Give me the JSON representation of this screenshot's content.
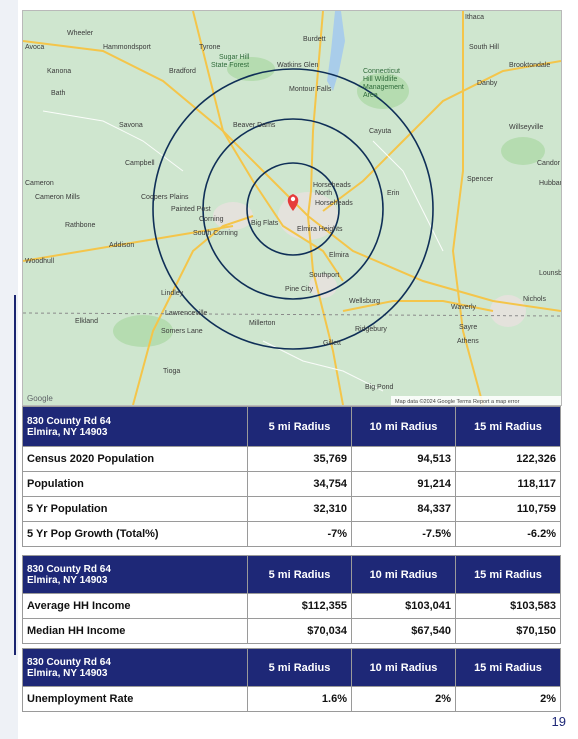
{
  "map": {
    "places": [
      "Ithaca",
      "South Hill",
      "Brooktondale",
      "Danby",
      "Wheeler",
      "Hammondsport",
      "Tyrone",
      "Burdett",
      "Avoca",
      "Kanona",
      "Bradford",
      "Sugar Hill State Forest",
      "Watkins Glen",
      "Connecticut Hill Wildlife Management Area",
      "Bath",
      "Montour Falls",
      "Savona",
      "Beaver Dams",
      "Cayuta",
      "Willseyville",
      "Campbell",
      "Candor",
      "Spencer",
      "Hubbard",
      "Cameron",
      "Cameron Mills",
      "Coopers Plains",
      "Painted Post",
      "Corning",
      "South Corning",
      "Big Flats",
      "Horseheads North",
      "Horseheads",
      "Elmira Heights",
      "Erin",
      "Rathbone",
      "Addison",
      "Elmira",
      "Woodhull",
      "Southport",
      "Pine City",
      "Lindley",
      "Wellsburg",
      "Waverly",
      "Nichols",
      "Lounsberry",
      "Lawrenceville",
      "Elkland",
      "Somers Lane",
      "Millerton",
      "Sayre",
      "Athens",
      "Ridgebury",
      "Gillett",
      "Tioga",
      "Big Pond"
    ],
    "attribution": "Map data ©2024 Google   Terms   Report a map error",
    "google_logo": "Google"
  },
  "tables": [
    {
      "address_line1": "830 County Rd 64",
      "address_line2": "Elmira, NY 14903",
      "col1": "5 mi Radius",
      "col2": "10 mi Radius",
      "col3": "15 mi Radius",
      "rows": [
        {
          "label": "Census 2020 Population",
          "v1": "35,769",
          "v2": "94,513",
          "v3": "122,326"
        },
        {
          "label": "Population",
          "v1": "34,754",
          "v2": "91,214",
          "v3": "118,117"
        },
        {
          "label": "5 Yr Population",
          "v1": "32,310",
          "v2": "84,337",
          "v3": "110,759"
        },
        {
          "label": "5 Yr Pop Growth (Total%)",
          "v1": "-7%",
          "v2": "-7.5%",
          "v3": "-6.2%"
        }
      ]
    },
    {
      "address_line1": "830 County Rd 64",
      "address_line2": "Elmira, NY 14903",
      "col1": "5 mi Radius",
      "col2": "10 mi Radius",
      "col3": "15 mi Radius",
      "rows": [
        {
          "label": "Average HH Income",
          "v1": "$112,355",
          "v2": "$103,041",
          "v3": "$103,583"
        },
        {
          "label": "Median HH Income",
          "v1": "$70,034",
          "v2": "$67,540",
          "v3": "$70,150"
        }
      ]
    },
    {
      "address_line1": "830 County Rd 64",
      "address_line2": "Elmira, NY 14903",
      "col1": "5 mi Radius",
      "col2": "10 mi Radius",
      "col3": "15 mi Radius",
      "rows": [
        {
          "label": "Unemployment Rate",
          "v1": "1.6%",
          "v2": "2%",
          "v3": "2%"
        }
      ]
    }
  ],
  "page_number": "19",
  "colors": {
    "header_bg": "#1e2877",
    "ring": "#0f2f57",
    "pin": "#e63b3b"
  }
}
